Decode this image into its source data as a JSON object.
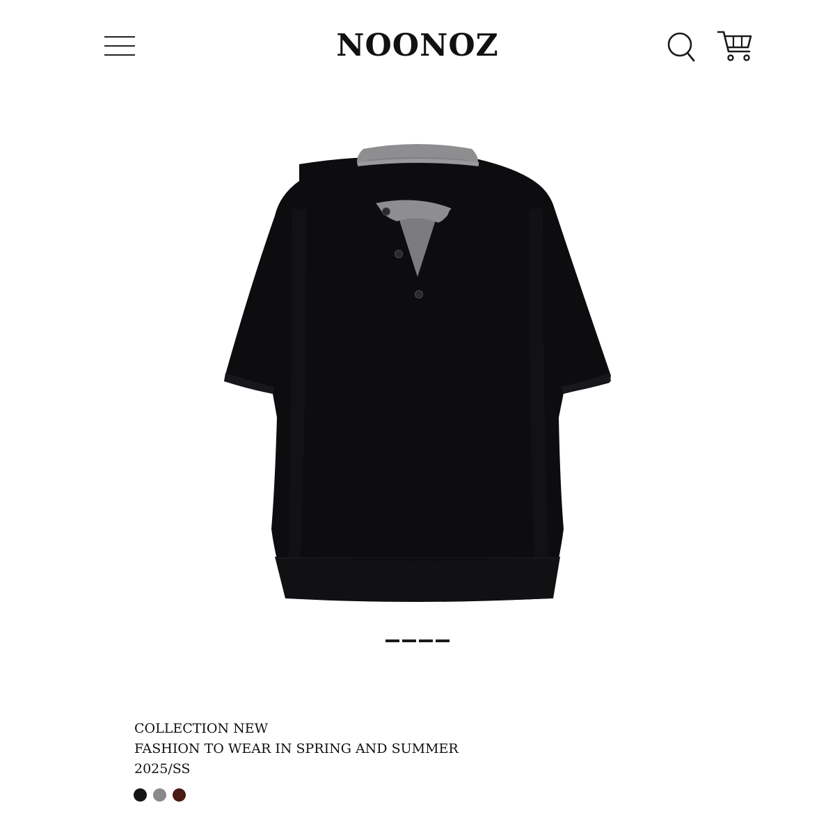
{
  "header": {
    "brand": "NOONOZ",
    "menu_icon": "hamburger-menu-icon",
    "search_icon": "search-icon",
    "cart_icon": "shopping-cart-icon"
  },
  "product": {
    "image_alt": "black short-sleeve knit top with grey layered collar",
    "colors": {
      "body": "#0d0d10",
      "collar": "#8e8e90"
    }
  },
  "carousel": {
    "total_slides": 4,
    "active_slide": 1
  },
  "info": {
    "line1": "COLLECTION NEW",
    "line2": "FASHION TO WEAR IN SPRING AND SUMMER",
    "line3": "2025/SS"
  },
  "swatches": [
    {
      "name": "black",
      "color": "#141414"
    },
    {
      "name": "grey",
      "color": "#8a8a8c"
    },
    {
      "name": "brown",
      "color": "#4a1a14"
    }
  ]
}
